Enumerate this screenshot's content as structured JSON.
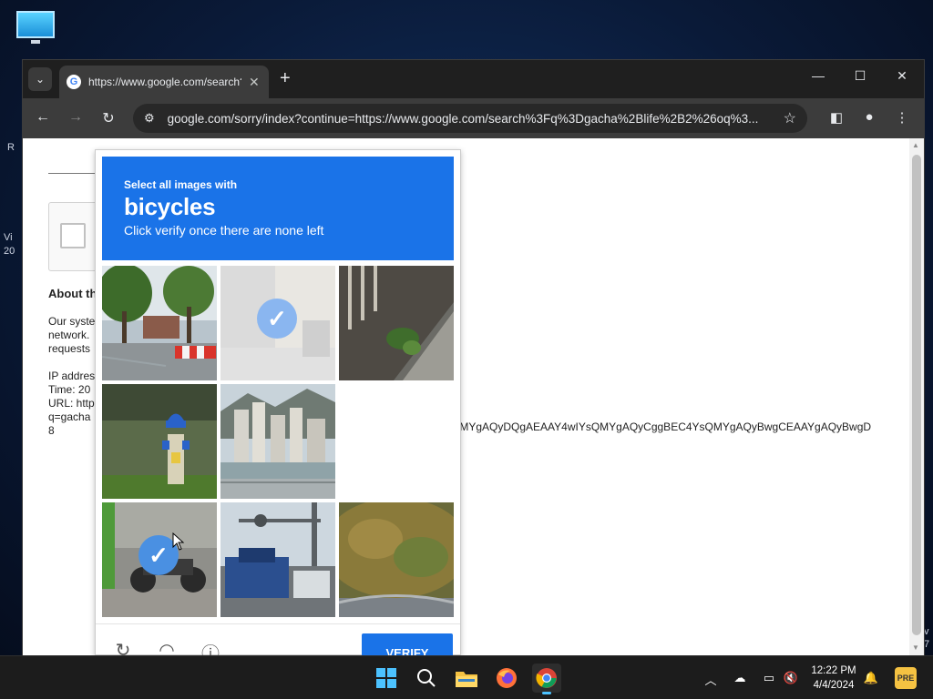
{
  "desktop": {
    "icon": "this-pc-icon",
    "edge_texts": [
      "R",
      "Vi",
      "20",
      "v",
      "7"
    ]
  },
  "browser": {
    "tab": {
      "title": "https://www.google.com/search?q",
      "favicon": "G"
    },
    "window_controls": {
      "minimize": "—",
      "maximize": "☐",
      "close": "✕"
    },
    "address_bar": {
      "url": "google.com/sorry/index?continue=https://www.google.com/search%3Fq%3Dgacha%2Blife%2B2%26oq%3..."
    }
  },
  "page": {
    "about_heading": "About th",
    "paragraph": [
      "Our syste",
      "network.",
      "requests"
    ],
    "details": [
      "IP addres",
      "Time: 20",
      "URL: http",
      "q=gacha",
      "8"
    ],
    "long_url_fragment": "QMYgAQyDQgAEAAY4wIYsQMYgAQyCggBEC4YsQMYgAQyBwgCEAAYgAQyBwgD"
  },
  "captcha": {
    "instruction_line1": "Select all images with",
    "keyword": "bicycles",
    "instruction_line3": "Click verify once there are none left",
    "verify_label": "VERIFY",
    "header_color": "#1a73e8",
    "tiles": [
      {
        "index": 0,
        "state": "unselected"
      },
      {
        "index": 1,
        "state": "selected"
      },
      {
        "index": 2,
        "state": "unselected"
      },
      {
        "index": 3,
        "state": "unselected"
      },
      {
        "index": 4,
        "state": "unselected"
      },
      {
        "index": 5,
        "state": "loading"
      },
      {
        "index": 6,
        "state": "selected"
      },
      {
        "index": 7,
        "state": "unselected"
      },
      {
        "index": 8,
        "state": "unselected"
      }
    ]
  },
  "taskbar": {
    "apps": [
      "start-icon",
      "search-icon",
      "file-explorer-icon",
      "firefox-icon",
      "chrome-icon"
    ],
    "clock": {
      "time": "12:22 PM",
      "date": "4/4/2024"
    }
  }
}
